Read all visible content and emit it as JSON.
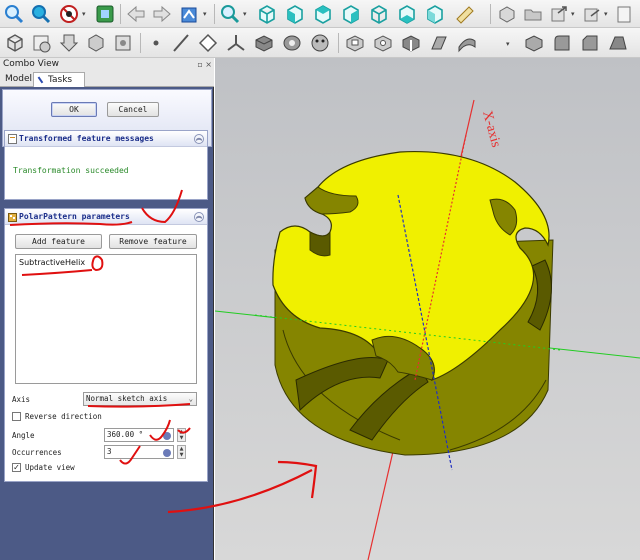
{
  "combo_view": {
    "title": "Combo View",
    "tabs": [
      {
        "label": "Model"
      },
      {
        "label": "Tasks"
      }
    ]
  },
  "dialog": {
    "ok_label": "OK",
    "cancel_label": "Cancel"
  },
  "messages": {
    "title": "Transformed feature messages",
    "text": "Transformation succeeded"
  },
  "polar_pattern": {
    "title": "PolarPattern parameters",
    "add_label": "Add feature",
    "remove_label": "Remove feature",
    "features": [
      "SubtractiveHelix"
    ],
    "axis_label": "Axis",
    "axis_value": "Normal sketch axis",
    "reverse_label": "Reverse direction",
    "reverse_checked": false,
    "angle_label": "Angle",
    "angle_value": "360.00 °",
    "occurrences_label": "Occurrences",
    "occurrences_value": "3",
    "update_label": "Update view",
    "update_checked": true
  },
  "viewport": {
    "axis_label": "X-axis",
    "part_color": "#f0f000",
    "x_axis_color": "#e63030",
    "y_axis_color": "#22cc22",
    "z_axis_color": "#2030c0"
  },
  "colors": {
    "panel_bg": "#4c5a86",
    "header_text": "#1b2e8a",
    "success_text": "#2a8a2a",
    "annotation": "#e01010"
  }
}
